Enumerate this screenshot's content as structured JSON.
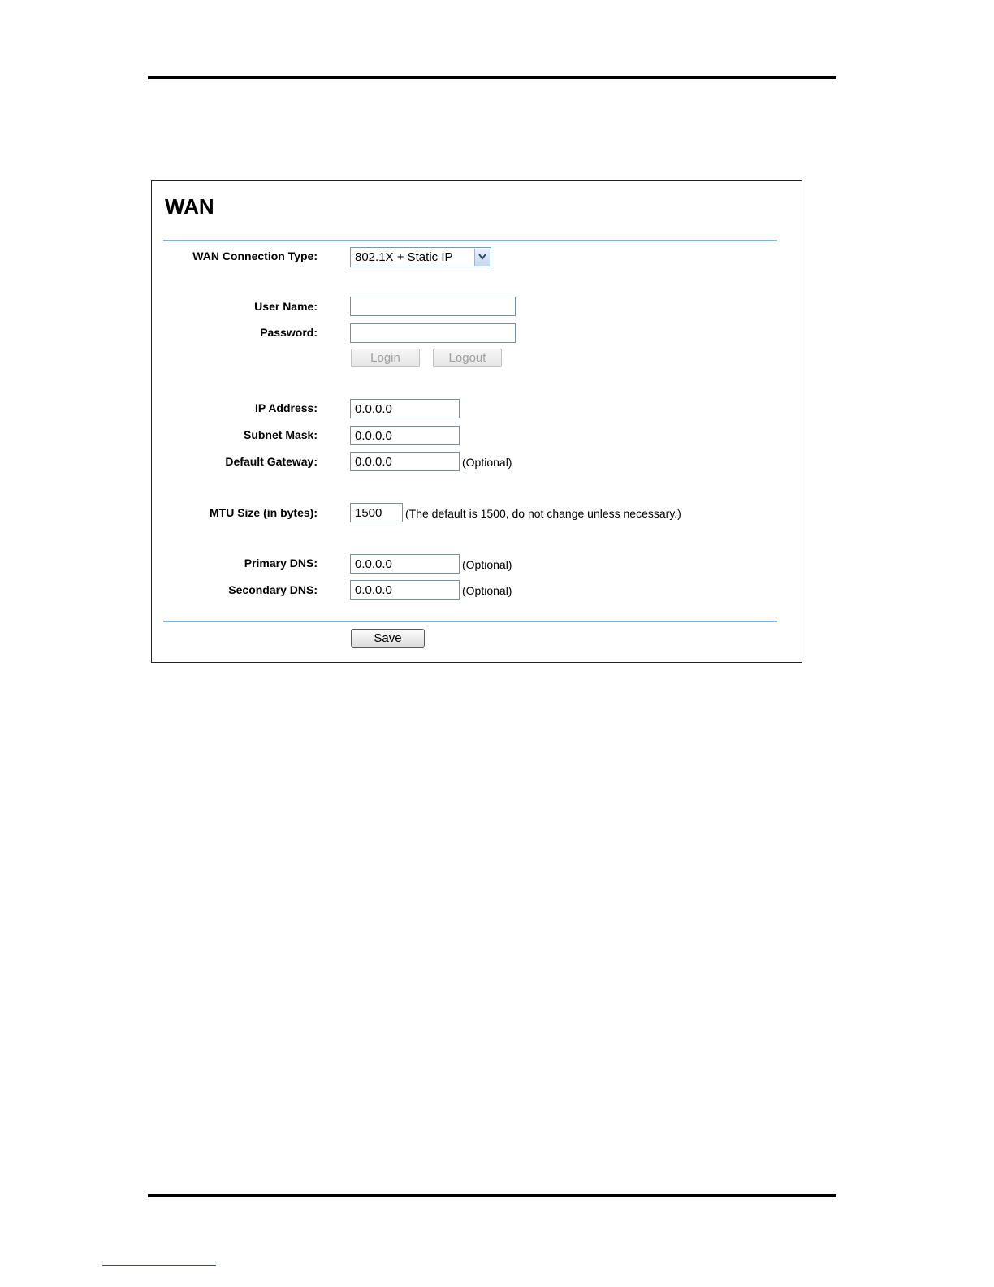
{
  "wan_panel": {
    "title": "WAN",
    "connection_type": {
      "label": "WAN Connection Type:",
      "selected": "802.1X + Static IP"
    },
    "user_name": {
      "label": "User Name:",
      "value": ""
    },
    "password": {
      "label": "Password:",
      "value": ""
    },
    "login_label": "Login",
    "logout_label": "Logout",
    "ip_address": {
      "label": "IP Address:",
      "value": "0.0.0.0"
    },
    "subnet_mask": {
      "label": "Subnet Mask:",
      "value": "0.0.0.0"
    },
    "default_gateway": {
      "label": "Default Gateway:",
      "value": "0.0.0.0",
      "note": "(Optional)"
    },
    "mtu": {
      "label": "MTU Size (in bytes):",
      "value": "1500",
      "note": "(The default is 1500, do not change unless necessary.)"
    },
    "primary_dns": {
      "label": "Primary DNS:",
      "value": "0.0.0.0",
      "note": "(Optional)"
    },
    "secondary_dns": {
      "label": "Secondary DNS:",
      "value": "0.0.0.0",
      "note": "(Optional)"
    },
    "save_label": "Save"
  }
}
